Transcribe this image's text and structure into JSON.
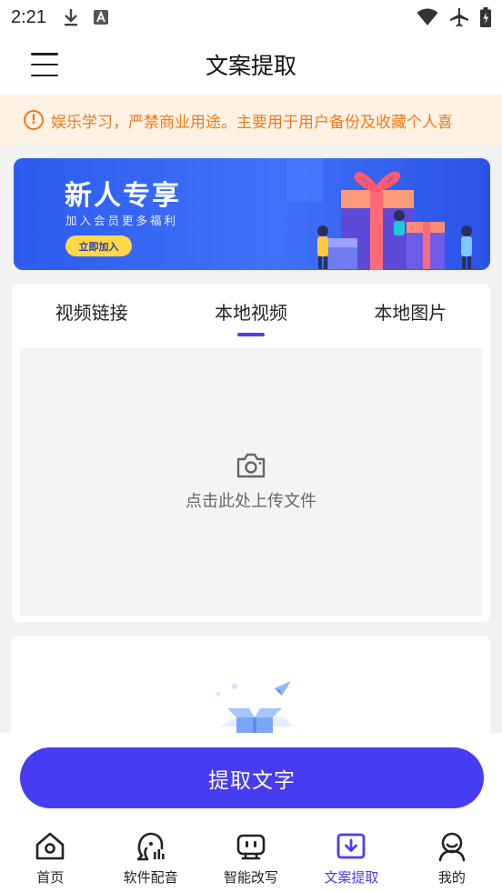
{
  "status_bar": {
    "time": "2:21",
    "icons": [
      "download-icon",
      "a-icon",
      "wifi-icon",
      "airplane-icon",
      "battery-icon"
    ]
  },
  "app_bar": {
    "title": "文案提取",
    "menu_icon": "menu-icon"
  },
  "notice": {
    "icon": "warning-icon",
    "text": "娱乐学习，严禁商业用途。主要用于用户备份及收藏个人喜"
  },
  "banner": {
    "title": "新人专享",
    "subtitle": "加入会员更多福利",
    "button_label": "立即加入"
  },
  "tabs": {
    "items": [
      {
        "label": "视频链接"
      },
      {
        "label": "本地视频"
      },
      {
        "label": "本地图片"
      }
    ],
    "active_index": 1
  },
  "upload": {
    "icon": "camera-icon",
    "text": "点击此处上传文件"
  },
  "primary_button": {
    "label": "提取文字"
  },
  "bottom_nav": {
    "items": [
      {
        "label": "首页",
        "icon": "home-icon"
      },
      {
        "label": "软件配音",
        "icon": "voice-icon"
      },
      {
        "label": "智能改写",
        "icon": "robot-icon"
      },
      {
        "label": "文案提取",
        "icon": "download-box-icon"
      },
      {
        "label": "我的",
        "icon": "profile-icon"
      }
    ],
    "active_index": 3
  },
  "colors": {
    "accent": "#463cf4",
    "notice_text": "#f07a1a",
    "notice_bg": "#fdf2e3",
    "banner_blue": "#3f72f8"
  }
}
